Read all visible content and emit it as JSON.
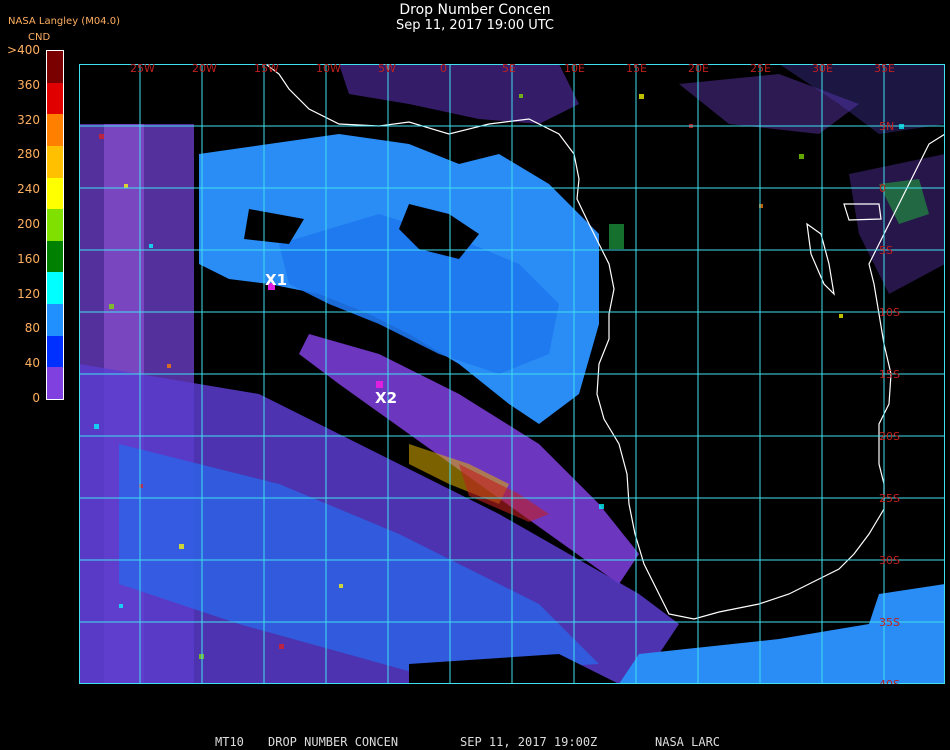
{
  "header": {
    "title": "Drop Number Concen",
    "subtitle": "Sep 11, 2017 19:00 UTC",
    "producer": "NASA Langley (M04.0)"
  },
  "colorbar": {
    "unit": "CND",
    "labels": [
      ">400",
      "360",
      "320",
      "280",
      "240",
      "200",
      "160",
      "120",
      "80",
      "40",
      "0"
    ],
    "colors": [
      "#7a0000",
      "#e00000",
      "#ff8000",
      "#ffc000",
      "#ffff00",
      "#80e000",
      "#008000",
      "#00ffff",
      "#2090ff",
      "#0030ff",
      "#8040e0"
    ]
  },
  "map": {
    "grid_color": "#40e0f0",
    "label_color": "#c02020",
    "coast_color": "#ffffff",
    "lon_labels": [
      "25W",
      "20W",
      "15W",
      "10W",
      "5W",
      "0",
      "5E",
      "10E",
      "15E",
      "20E",
      "25E",
      "30E",
      "35E"
    ],
    "lat_labels": [
      "5N",
      "0",
      "5S",
      "10S",
      "15S",
      "20S",
      "25S",
      "30S",
      "35S",
      "40S"
    ],
    "markers": [
      {
        "id": "X1",
        "label": "X1"
      },
      {
        "id": "X2",
        "label": "X2"
      }
    ]
  },
  "footer": {
    "product": "MT10",
    "parameter": "DROP NUMBER CONCEN",
    "datetime": "SEP 11, 2017 19:00Z",
    "source": "NASA LARC"
  }
}
